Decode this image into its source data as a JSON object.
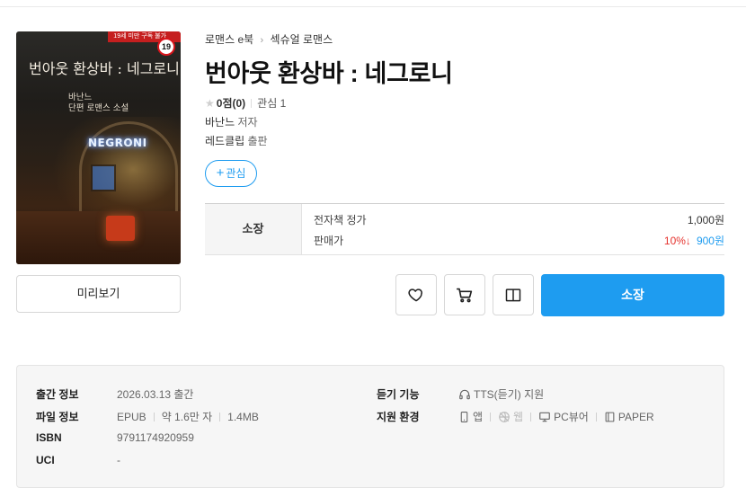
{
  "cover": {
    "title_text": "번아웃 환상바 : 네그로니",
    "subtitle_line1": "바난느",
    "subtitle_line2": "단편 로맨스 소설",
    "neon_text": "NEGRONI",
    "red_tag": "19세 미만 구독 불가",
    "age_badge": "19"
  },
  "preview_label": "미리보기",
  "breadcrumb": {
    "level1": "로맨스 e북",
    "separator": "›",
    "level2": "섹슈얼 로맨스"
  },
  "book": {
    "title": "번아웃 환상바 : 네그로니",
    "rating_score": "0점(0)",
    "wish_count": "관심 1",
    "author_name": "바난느",
    "author_role": "저자",
    "publisher_name": "레드클립",
    "publisher_role": "출판"
  },
  "wish_button": {
    "plus": "+",
    "label": "관심"
  },
  "price": {
    "own_label": "소장",
    "list_label": "전자책 정가",
    "list_value": "1,000원",
    "sale_label": "판매가",
    "discount": "10%↓",
    "sale_value": "900원"
  },
  "actions": {
    "buy_label": "소장"
  },
  "info": {
    "release_label": "출간 정보",
    "release_value": "2026.03.13 출간",
    "file_label": "파일 정보",
    "file_format": "EPUB",
    "file_chars": "약 1.6만 자",
    "file_size": "1.4MB",
    "isbn_label": "ISBN",
    "isbn_value": "9791174920959",
    "uci_label": "UCI",
    "uci_value": "-",
    "listen_label": "듣기 기능",
    "listen_value": "TTS(듣기) 지원",
    "env_label": "지원 환경",
    "env_app": "앱",
    "env_web": "웹",
    "env_pc": "PC뷰어",
    "env_paper": "PAPER"
  },
  "colors": {
    "accent": "#1e9cf0",
    "discount": "#e5322d",
    "age_badge_border": "#d9141b"
  }
}
